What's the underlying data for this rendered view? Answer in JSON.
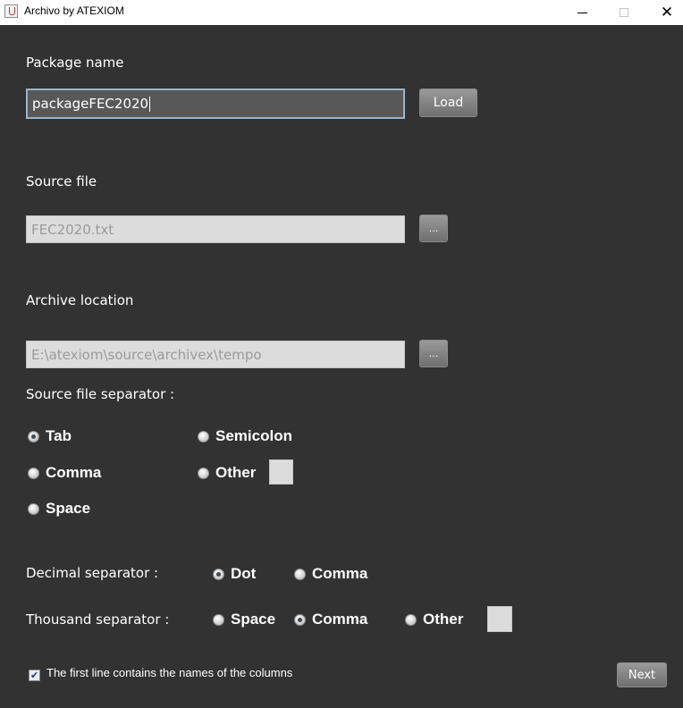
{
  "window": {
    "title": "Archivo by ATEXIOM",
    "close_glyph": "✕"
  },
  "package": {
    "label": "Package name",
    "value": "packageFEC2020",
    "load_button": "Load"
  },
  "source": {
    "label": "Source file",
    "value": "FEC2020.txt",
    "browse_button": "..."
  },
  "archive": {
    "label": "Archive location",
    "value": "E:\\atexiom\\source\\archivex\\tempo",
    "browse_button": "..."
  },
  "file_separator": {
    "label": "Source file separator :",
    "options": [
      "Tab",
      "Semicolon",
      "Comma",
      "Other",
      "Space"
    ],
    "selected": "Tab"
  },
  "decimal_separator": {
    "label": "Decimal separator :",
    "options": [
      "Dot",
      "Comma"
    ],
    "selected": "Dot"
  },
  "thousand_separator": {
    "label": "Thousand separator :",
    "options": [
      "Space",
      "Comma",
      "Other"
    ],
    "selected": "Comma"
  },
  "header_row": {
    "label": "The first line contains the names of the columns",
    "checked": true,
    "check_glyph": "✔"
  },
  "next_button": "Next"
}
